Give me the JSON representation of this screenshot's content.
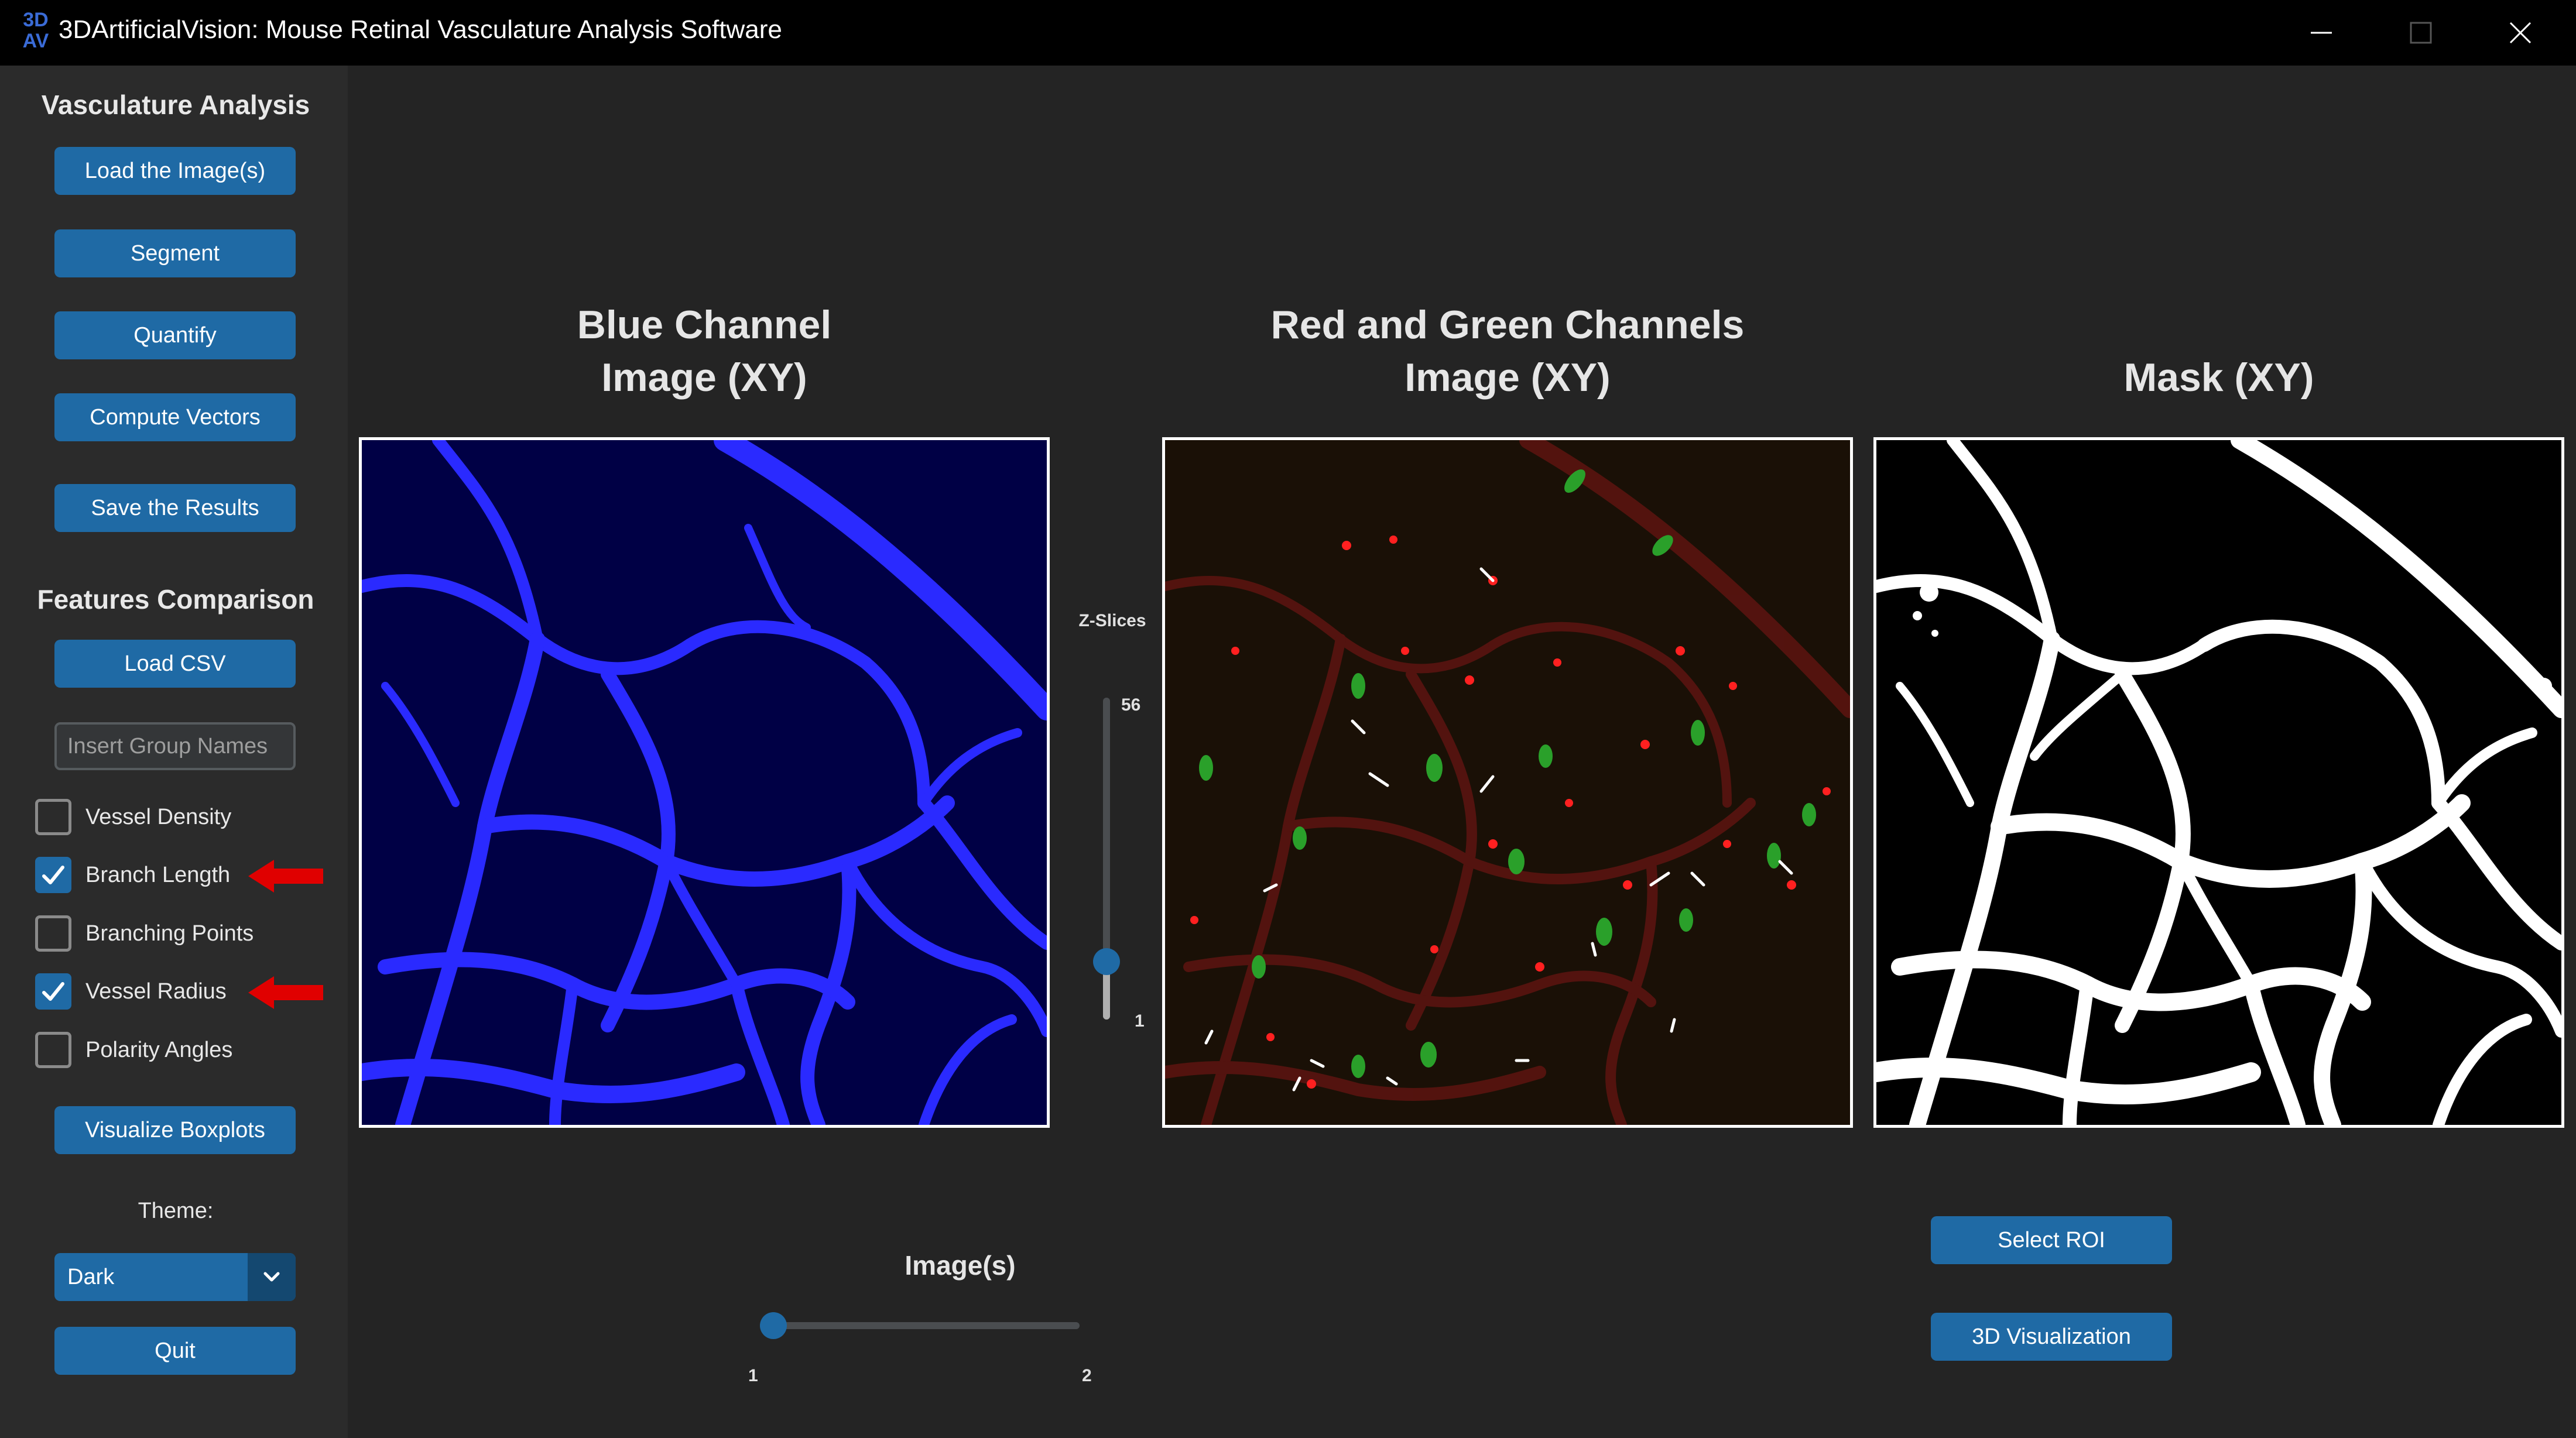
{
  "window": {
    "logo_text": "3D\nAV",
    "title": "3DArtificialVision: Mouse Retinal Vasculature Analysis Software"
  },
  "sidebar": {
    "vasculature_title": "Vasculature Analysis",
    "buttons": {
      "load_images": "Load the Image(s)",
      "segment": "Segment",
      "quantify": "Quantify",
      "compute_vectors": "Compute Vectors",
      "save_results": "Save the Results",
      "load_csv": "Load CSV",
      "visualize_boxplots": "Visualize Boxplots",
      "quit": "Quit"
    },
    "features_title": "Features Comparison",
    "group_names_placeholder": "Insert Group Names",
    "features": [
      {
        "label": "Vessel Density",
        "checked": false
      },
      {
        "label": "Branch Length",
        "checked": true
      },
      {
        "label": "Branching Points",
        "checked": false
      },
      {
        "label": "Vessel Radius",
        "checked": true
      },
      {
        "label": "Polarity Angles",
        "checked": false
      }
    ],
    "theme_label": "Theme:",
    "theme_value": "Dark"
  },
  "main": {
    "panels": [
      {
        "title": "Blue Channel\nImage (XY)"
      },
      {
        "title": "Red and Green Channels\nImage (XY)"
      },
      {
        "title": "Mask (XY)"
      }
    ],
    "zslices": {
      "label": "Z-Slices",
      "max": "56",
      "min": "1",
      "value_fraction": 0.18
    },
    "images_slider": {
      "label": "Image(s)",
      "min": "1",
      "max": "2",
      "value_fraction": 0.0
    },
    "select_roi": "Select ROI",
    "visualization_3d": "3D Visualization"
  },
  "colors": {
    "accent": "#1f6aa5",
    "background": "#242424",
    "sidebar": "#2b2b2b",
    "arrow": "#e00000"
  }
}
